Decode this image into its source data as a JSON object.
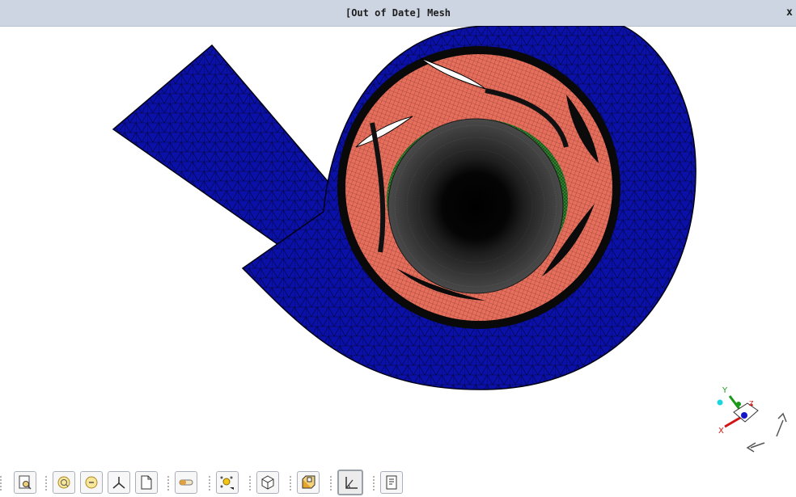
{
  "window": {
    "title": "[Out of Date] Mesh",
    "close_label": "x"
  },
  "viewport": {
    "colors": {
      "volute": "#0a10a8",
      "impeller": "#e56f5c",
      "ring": "#2f7d2f",
      "hub": "#3a3a3a",
      "background": "#ffffff"
    }
  },
  "triad": {
    "y_label": "Y",
    "x_label": "X",
    "z_label": "Z"
  },
  "toolbar": {
    "buttons": [
      {
        "name": "fit-view-icon"
      },
      {
        "name": "zoom-box-icon"
      },
      {
        "name": "zoom-in-icon"
      },
      {
        "name": "zoom-out-icon"
      },
      {
        "name": "axes-icon"
      },
      {
        "name": "page-icon"
      },
      {
        "name": "clipping-icon"
      },
      {
        "name": "lights-icon"
      },
      {
        "name": "cube-icon"
      },
      {
        "name": "box-view-icon"
      },
      {
        "name": "plot-icon"
      },
      {
        "name": "report-icon"
      }
    ]
  }
}
